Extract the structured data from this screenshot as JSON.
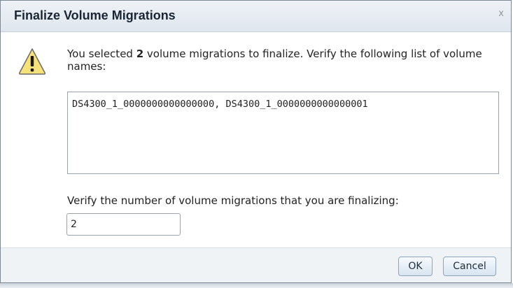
{
  "dialog": {
    "title": "Finalize Volume Migrations",
    "close_label": "x"
  },
  "message": {
    "prefix": "You selected ",
    "count": "2",
    "suffix": " volume migrations to finalize. Verify the following list of volume names:"
  },
  "volume_names": "DS4300_1_0000000000000000, DS4300_1_0000000000000001",
  "verify": {
    "label": "Verify the number of volume migrations that you are finalizing:",
    "value": "2"
  },
  "buttons": {
    "ok_label": "OK",
    "cancel_label": "Cancel"
  },
  "icons": {
    "warning": "warning-icon"
  },
  "colors": {
    "warning_fill": "#f7e27a",
    "warning_stroke": "#6b6b6b"
  }
}
